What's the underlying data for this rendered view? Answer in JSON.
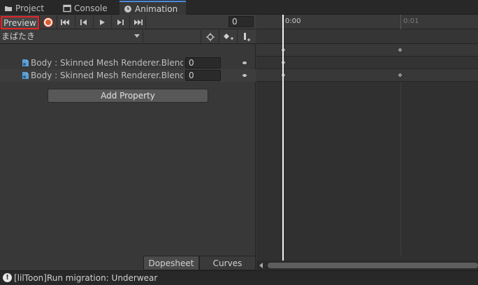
{
  "tabs": [
    {
      "label": "Project",
      "icon": "folder-icon"
    },
    {
      "label": "Console",
      "icon": "console-icon"
    },
    {
      "label": "Animation",
      "icon": "clock-icon",
      "active": true
    }
  ],
  "toolbar": {
    "preview_label": "Preview",
    "frame_value": "0",
    "record_color": "#e05a2a",
    "highlight_color": "#e0262a"
  },
  "clip": {
    "selected": "まばたき"
  },
  "properties": [
    {
      "label": "Body : Skinned Mesh Renderer.Blend S",
      "value": "0"
    },
    {
      "label": "Body : Skinned Mesh Renderer.Blend S",
      "value": "0"
    }
  ],
  "add_property_label": "Add Property",
  "bottom_tabs": {
    "dopesheet": "Dopesheet",
    "curves": "Curves"
  },
  "timeline": {
    "ticks": [
      {
        "label": "0:00"
      },
      {
        "label": "0:01"
      }
    ]
  },
  "status": {
    "message": "[lilToon]Run migration: Underwear"
  }
}
